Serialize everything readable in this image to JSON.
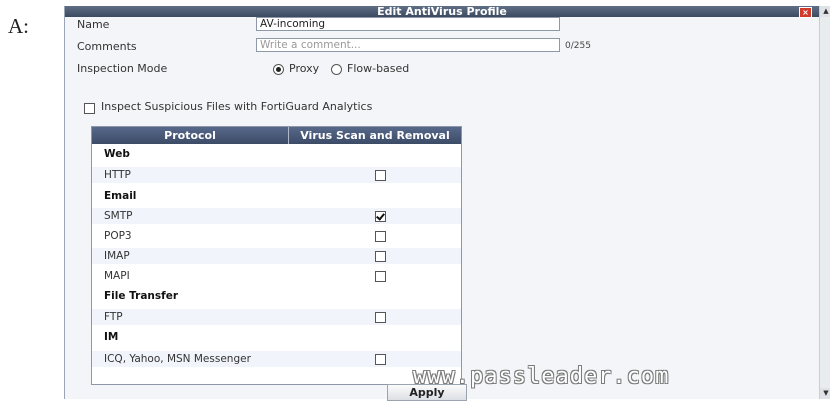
{
  "answer_prefix": "A:",
  "dialog": {
    "title": "Edit AntiVirus Profile",
    "close_glyph": "×"
  },
  "form": {
    "name_label": "Name",
    "name_value": "AV-incoming",
    "comments_label": "Comments",
    "comments_placeholder": "Write a comment...",
    "comments_counter": "0/255",
    "inspection_label": "Inspection Mode",
    "inspection_options": [
      "Proxy",
      "Flow-based"
    ],
    "inspection_selected": "Proxy",
    "suspicious_label": "Inspect Suspicious Files with FortiGuard Analytics",
    "suspicious_checked": false
  },
  "table": {
    "headers": [
      "Protocol",
      "Virus Scan and Removal"
    ],
    "rows": [
      {
        "label": "Web",
        "group": true
      },
      {
        "label": "HTTP",
        "checked": false
      },
      {
        "label": "Email",
        "group": true
      },
      {
        "label": "SMTP",
        "checked": true
      },
      {
        "label": "POP3",
        "checked": false
      },
      {
        "label": "IMAP",
        "checked": false
      },
      {
        "label": "MAPI",
        "checked": false
      },
      {
        "label": "File Transfer",
        "group": true
      },
      {
        "label": "FTP",
        "checked": false
      },
      {
        "label": "IM",
        "group": true
      },
      {
        "label": "ICQ, Yahoo, MSN Messenger",
        "checked": false
      }
    ]
  },
  "footer": {
    "apply_label": "Apply",
    "watermark": "www.passleader.com"
  },
  "scrollbar": {
    "up_glyph": "▲",
    "down_glyph": "▼"
  },
  "colors": {
    "titlebar": "#4a5a73",
    "table_header": "#4a5a78",
    "close_button": "#d23a2a"
  }
}
